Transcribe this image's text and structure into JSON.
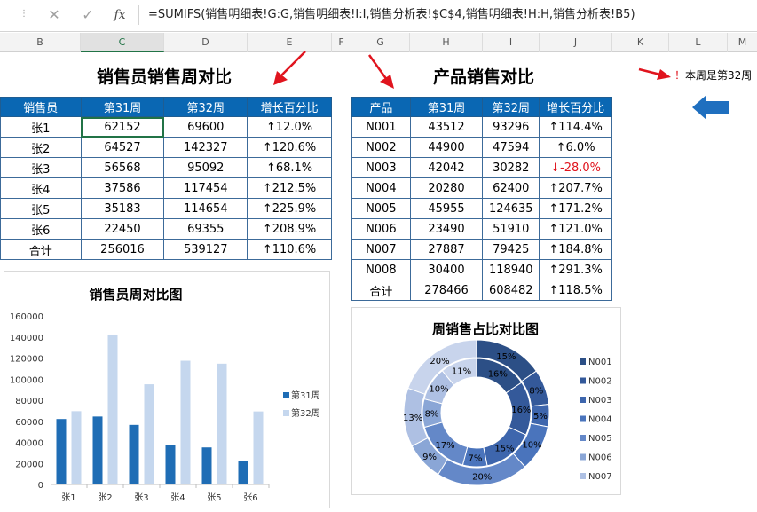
{
  "formula": {
    "cancel_icon": "close-icon",
    "confirm_icon": "check-icon",
    "fx_label": "fx",
    "text": "=SUMIFS(销售明细表!G:G,销售明细表!I:I,销售分析表!$C$4,销售明细表!H:H,销售分析表!B5)"
  },
  "columns": [
    "B",
    "C",
    "D",
    "E",
    "F",
    "G",
    "H",
    "I",
    "J",
    "K",
    "L",
    "M"
  ],
  "selected_column": "C",
  "left_table": {
    "title": "销售员销售周对比",
    "headers": [
      "销售员",
      "第31周",
      "第32周",
      "增长百分比"
    ],
    "rows": [
      {
        "name": "张1",
        "w31": "62152",
        "w32": "69600",
        "pct": "↑12.0%"
      },
      {
        "name": "张2",
        "w31": "64527",
        "w32": "142327",
        "pct": "↑120.6%"
      },
      {
        "name": "张3",
        "w31": "56568",
        "w32": "95092",
        "pct": "↑68.1%"
      },
      {
        "name": "张4",
        "w31": "37586",
        "w32": "117454",
        "pct": "↑212.5%"
      },
      {
        "name": "张5",
        "w31": "35183",
        "w32": "114654",
        "pct": "↑225.9%"
      },
      {
        "name": "张6",
        "w31": "22450",
        "w32": "69355",
        "pct": "↑208.9%"
      },
      {
        "name": "合计",
        "w31": "256016",
        "w32": "539127",
        "pct": "↑110.6%"
      }
    ]
  },
  "right_table": {
    "title": "产品销售对比",
    "headers": [
      "产品",
      "第31周",
      "第32周",
      "增长百分比"
    ],
    "rows": [
      {
        "name": "N001",
        "w31": "43512",
        "w32": "93296",
        "pct": "↑114.4%"
      },
      {
        "name": "N002",
        "w31": "44900",
        "w32": "47594",
        "pct": "↑6.0%"
      },
      {
        "name": "N003",
        "w31": "42042",
        "w32": "30282",
        "pct": "↓-28.0%"
      },
      {
        "name": "N004",
        "w31": "20280",
        "w32": "62400",
        "pct": "↑207.7%"
      },
      {
        "name": "N005",
        "w31": "45955",
        "w32": "124635",
        "pct": "↑171.2%"
      },
      {
        "name": "N006",
        "w31": "23490",
        "w32": "51910",
        "pct": "↑121.0%"
      },
      {
        "name": "N007",
        "w31": "27887",
        "w32": "79425",
        "pct": "↑184.8%"
      },
      {
        "name": "N008",
        "w31": "30400",
        "w32": "118940",
        "pct": "↑291.3%"
      },
      {
        "name": "合计",
        "w31": "278466",
        "w32": "608482",
        "pct": "↑118.5%"
      }
    ]
  },
  "note": {
    "bang": "！",
    "text": "本周是第32周"
  },
  "colors": {
    "header_blue": "#0a67b3",
    "bar_dark": "#1f6db5",
    "bar_light": "#c5d7ee",
    "arrow_red": "#e0141e",
    "arrow_blue": "#1f6fbf",
    "pct_blue": "#1f2bd1"
  },
  "chart_data": [
    {
      "type": "bar",
      "title": "销售员周对比图",
      "categories": [
        "张1",
        "张2",
        "张3",
        "张4",
        "张5",
        "张6"
      ],
      "series": [
        {
          "name": "第31周",
          "values": [
            62152,
            64527,
            56568,
            37586,
            35183,
            22450
          ],
          "color": "#1f6db5"
        },
        {
          "name": "第32周",
          "values": [
            69600,
            142327,
            95092,
            117454,
            114654,
            69355
          ],
          "color": "#c5d7ee"
        }
      ],
      "ylim": [
        0,
        160000
      ],
      "yticks": [
        "0",
        "20000",
        "40000",
        "60000",
        "80000",
        "100000",
        "120000",
        "140000",
        "160000"
      ],
      "legend": "right"
    },
    {
      "type": "pie",
      "title": "周销售占比对比图",
      "categories": [
        "N001",
        "N002",
        "N003",
        "N004",
        "N005",
        "N006",
        "N007",
        "N008"
      ],
      "inner_labels": [
        "16%",
        "16%",
        "15%",
        "7%",
        "17%",
        "8%",
        "10%",
        "11%"
      ],
      "outer_labels": [
        "15%",
        "8%",
        "5%",
        "10%",
        "20%",
        "9%",
        "13%",
        "20%"
      ],
      "inner_values": [
        43512,
        44900,
        42042,
        20280,
        45955,
        23490,
        27887,
        30400
      ],
      "outer_values": [
        93296,
        47594,
        30282,
        62400,
        124635,
        51910,
        79425,
        118940
      ],
      "colors": [
        "#2c4f86",
        "#34599a",
        "#3e66ad",
        "#4a74bc",
        "#6488c8",
        "#8aa6d6",
        "#aec0e3",
        "#c8d4ec"
      ],
      "legend_items": [
        "N001",
        "N002",
        "N003",
        "N004",
        "N005",
        "N006",
        "N007"
      ],
      "legend": "right"
    }
  ]
}
